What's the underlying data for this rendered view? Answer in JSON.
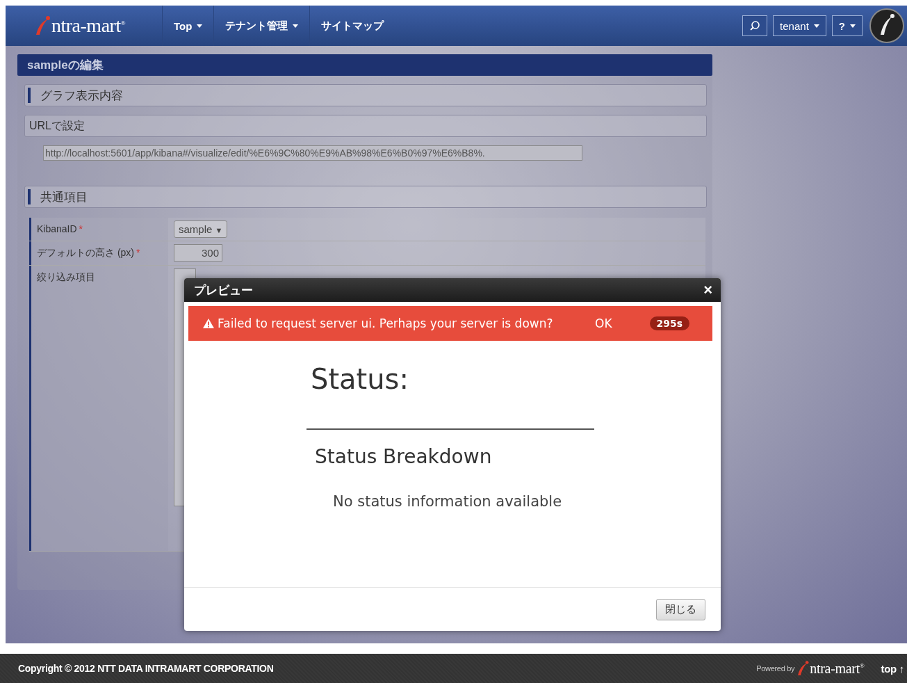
{
  "navbar": {
    "logo": "ntra-mart",
    "logo_mark": "®",
    "menus": [
      {
        "label": "Top",
        "dropdown": true
      },
      {
        "label": "テナント管理",
        "dropdown": true
      },
      {
        "label": "サイトマップ",
        "dropdown": false
      }
    ],
    "user_menu": "tenant",
    "help_menu": "?"
  },
  "panel": {
    "title": "sampleの編集",
    "sections": [
      {
        "kind": "heading",
        "label": "グラフ表示内容"
      },
      {
        "kind": "subheading",
        "label": "URLで設定"
      },
      {
        "kind": "url",
        "value": "http://localhost:5601/app/kibana#/visualize/edit/%E6%9C%80%E9%AB%98%E6%B0%97%E6%B8%."
      },
      {
        "kind": "heading",
        "label": "共通項目"
      }
    ],
    "required_mark": "*",
    "fields": [
      {
        "label": "KibanaID",
        "required": true,
        "kind": "select",
        "value": "sample",
        "arrow": "▼"
      },
      {
        "label": "デフォルトの高さ (px)",
        "required": true,
        "kind": "number",
        "value": "300"
      },
      {
        "label": "絞り込み項目",
        "required": false,
        "kind": "list"
      }
    ]
  },
  "modal": {
    "title": "プレビュー",
    "close": "×",
    "alert": {
      "message": "Failed to request server ui. Perhaps your server is down?",
      "action": "OK",
      "countdown": "295s"
    },
    "status_title": "Status:",
    "breakdown_title": "Status Breakdown",
    "empty_message": "No status information available",
    "button": "閉じる"
  },
  "footer": {
    "copyright": "Copyright © 2012 NTT DATA INTRAMART CORPORATION",
    "powered_by": "Powered by",
    "logo": "ntra-mart",
    "logo_mark": "®",
    "top_link": "top ↑"
  }
}
